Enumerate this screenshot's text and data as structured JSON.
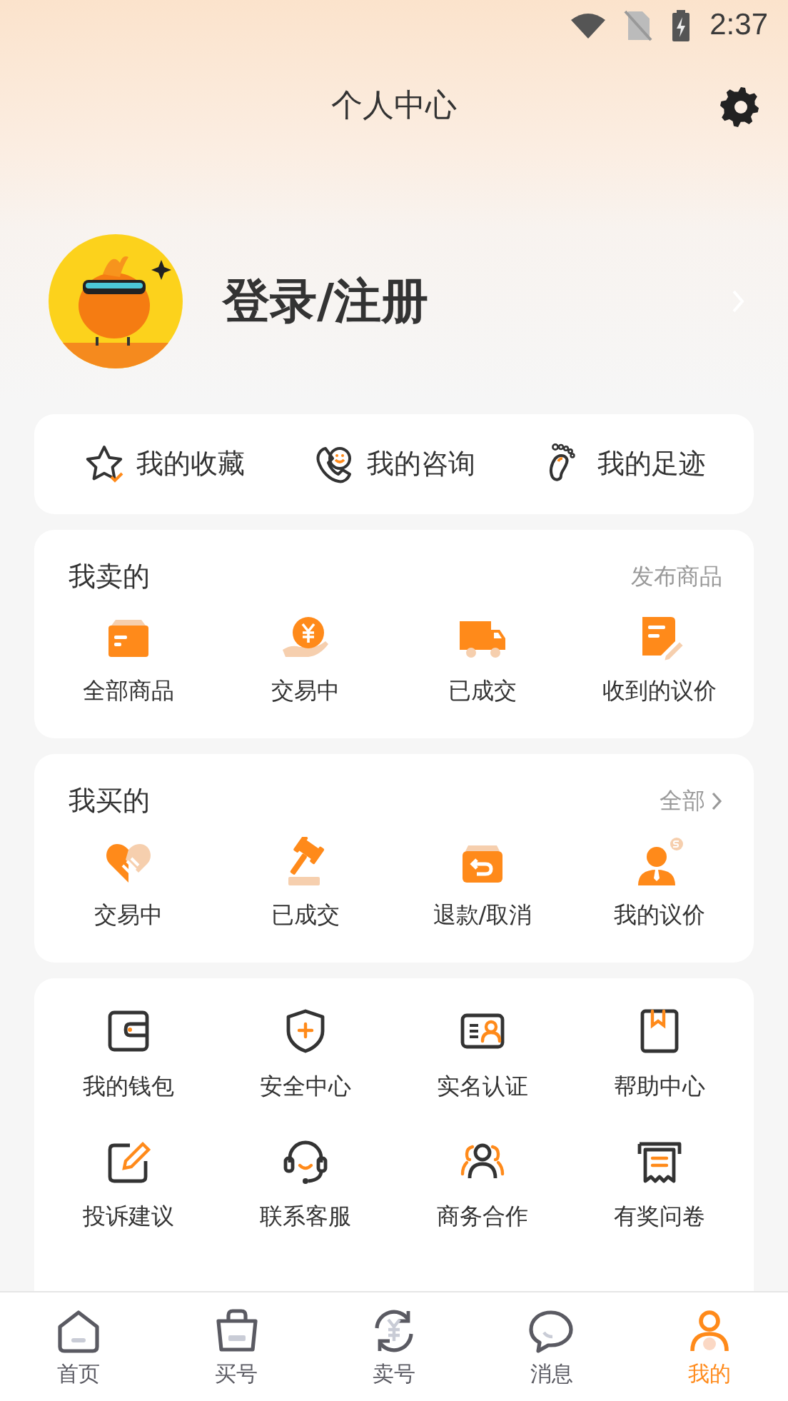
{
  "status_bar": {
    "time": "2:37"
  },
  "header": {
    "title": "个人中心"
  },
  "profile": {
    "login_label": "登录/注册"
  },
  "quick_links": [
    {
      "label": "我的收藏"
    },
    {
      "label": "我的咨询"
    },
    {
      "label": "我的足迹"
    }
  ],
  "selling": {
    "title": "我卖的",
    "action": "发布商品",
    "items": [
      {
        "label": "全部商品"
      },
      {
        "label": "交易中"
      },
      {
        "label": "已成交"
      },
      {
        "label": "收到的议价"
      }
    ]
  },
  "buying": {
    "title": "我买的",
    "action": "全部",
    "items": [
      {
        "label": "交易中"
      },
      {
        "label": "已成交"
      },
      {
        "label": "退款/取消"
      },
      {
        "label": "我的议价"
      }
    ]
  },
  "services": {
    "items": [
      {
        "label": "我的钱包"
      },
      {
        "label": "安全中心"
      },
      {
        "label": "实名认证"
      },
      {
        "label": "帮助中心"
      },
      {
        "label": "投诉建议"
      },
      {
        "label": "联系客服"
      },
      {
        "label": "商务合作"
      },
      {
        "label": "有奖问卷"
      }
    ]
  },
  "tab_bar": [
    {
      "label": "首页",
      "selected": false
    },
    {
      "label": "买号",
      "selected": false
    },
    {
      "label": "卖号",
      "selected": false
    },
    {
      "label": "消息",
      "selected": false
    },
    {
      "label": "我的",
      "selected": true
    }
  ]
}
